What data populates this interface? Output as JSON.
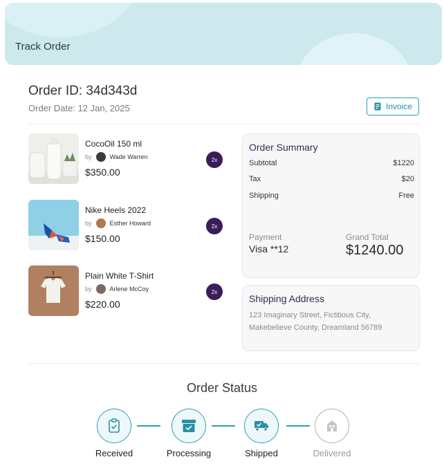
{
  "header": {
    "title": "Track Order"
  },
  "order": {
    "id_label": "Order ID: 34d343d",
    "date_label": "Order Date: 12 Jan, 2025",
    "invoice_label": "Invoice"
  },
  "items": [
    {
      "name": "CocoOil 150 ml",
      "by": "by",
      "seller": "Wade Warren",
      "price": "$350.00",
      "qty": "2x"
    },
    {
      "name": "Nike Heels 2022",
      "by": "by",
      "seller": "Esther Howard",
      "price": "$150.00",
      "qty": "2x"
    },
    {
      "name": "Plain White T-Shirt",
      "by": "by",
      "seller": "Arlene McCoy",
      "price": "$220.00",
      "qty": "2x"
    }
  ],
  "summary": {
    "title": "Order Summary",
    "rows": [
      {
        "label": "Subtotal",
        "value": "$1220"
      },
      {
        "label": "Tax",
        "value": "$20"
      },
      {
        "label": "Shipping",
        "value": "Free"
      }
    ],
    "payment_label": "Payment",
    "payment_value": "Visa **12",
    "total_label": "Grand Total",
    "total_value": "$1240.00"
  },
  "shipping": {
    "title": "Shipping Address",
    "address": "123 Imaginary Street, Fictitious City, Makebelieve County, Dreamland 56789"
  },
  "status": {
    "title": "Order Status",
    "steps": [
      {
        "label": "Received",
        "done": true,
        "icon": "clipboard-check-icon"
      },
      {
        "label": "Processing",
        "done": true,
        "icon": "box-icon"
      },
      {
        "label": "Shipped",
        "done": true,
        "icon": "truck-icon"
      },
      {
        "label": "Delivered",
        "done": false,
        "icon": "building-icon"
      }
    ]
  },
  "colors": {
    "accent": "#2aa0b2",
    "qty_badge": "#3a1d5a",
    "header_bg": "#cde9ee",
    "pending": "#b0b0b0"
  }
}
